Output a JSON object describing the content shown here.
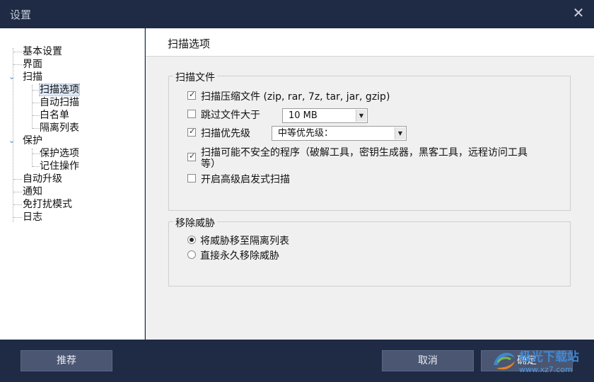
{
  "window": {
    "title": "设置",
    "close_glyph": "✕"
  },
  "nav": {
    "items": [
      {
        "label": "基本设置"
      },
      {
        "label": "界面"
      },
      {
        "label": "扫描"
      },
      {
        "label": "扫描选项"
      },
      {
        "label": "自动扫描"
      },
      {
        "label": "白名单"
      },
      {
        "label": "隔离列表"
      },
      {
        "label": "保护"
      },
      {
        "label": "保护选项"
      },
      {
        "label": "记住操作"
      },
      {
        "label": "自动升级"
      },
      {
        "label": "通知"
      },
      {
        "label": "免打扰模式"
      },
      {
        "label": "日志"
      }
    ],
    "selected": "扫描选项"
  },
  "page": {
    "title": "扫描选项",
    "scan_files": {
      "group_title": "扫描文件",
      "options": [
        {
          "label": "扫描压缩文件 (zip, rar, 7z, tar, jar, gzip)",
          "checked": true
        },
        {
          "label": "跳过文件大于",
          "checked": false
        },
        {
          "label": "扫描优先级",
          "checked": true
        },
        {
          "label": "扫描可能不安全的程序（破解工具，密钥生成器，黑客工具，远程访问工具",
          "label2": "等）",
          "checked": true
        },
        {
          "label": "开启高级启发式扫描",
          "checked": false
        }
      ],
      "size_select": {
        "value": "10 MB"
      },
      "priority_select": {
        "value": "中等优先级："
      }
    },
    "remove_threats": {
      "group_title": "移除威胁",
      "options": [
        {
          "label": "将威胁移至隔离列表",
          "selected": true
        },
        {
          "label": "直接永久移除威胁",
          "selected": false
        }
      ]
    }
  },
  "footer": {
    "recommend_label": "推荐",
    "cancel_label": "取消",
    "ok_label": "确定"
  },
  "watermark": {
    "line1": "极光下载站",
    "line2": "www.xz7.com"
  },
  "colors": {
    "chrome": "#1f2a44",
    "button": "#4a5672",
    "selected": "#dde8f7"
  }
}
